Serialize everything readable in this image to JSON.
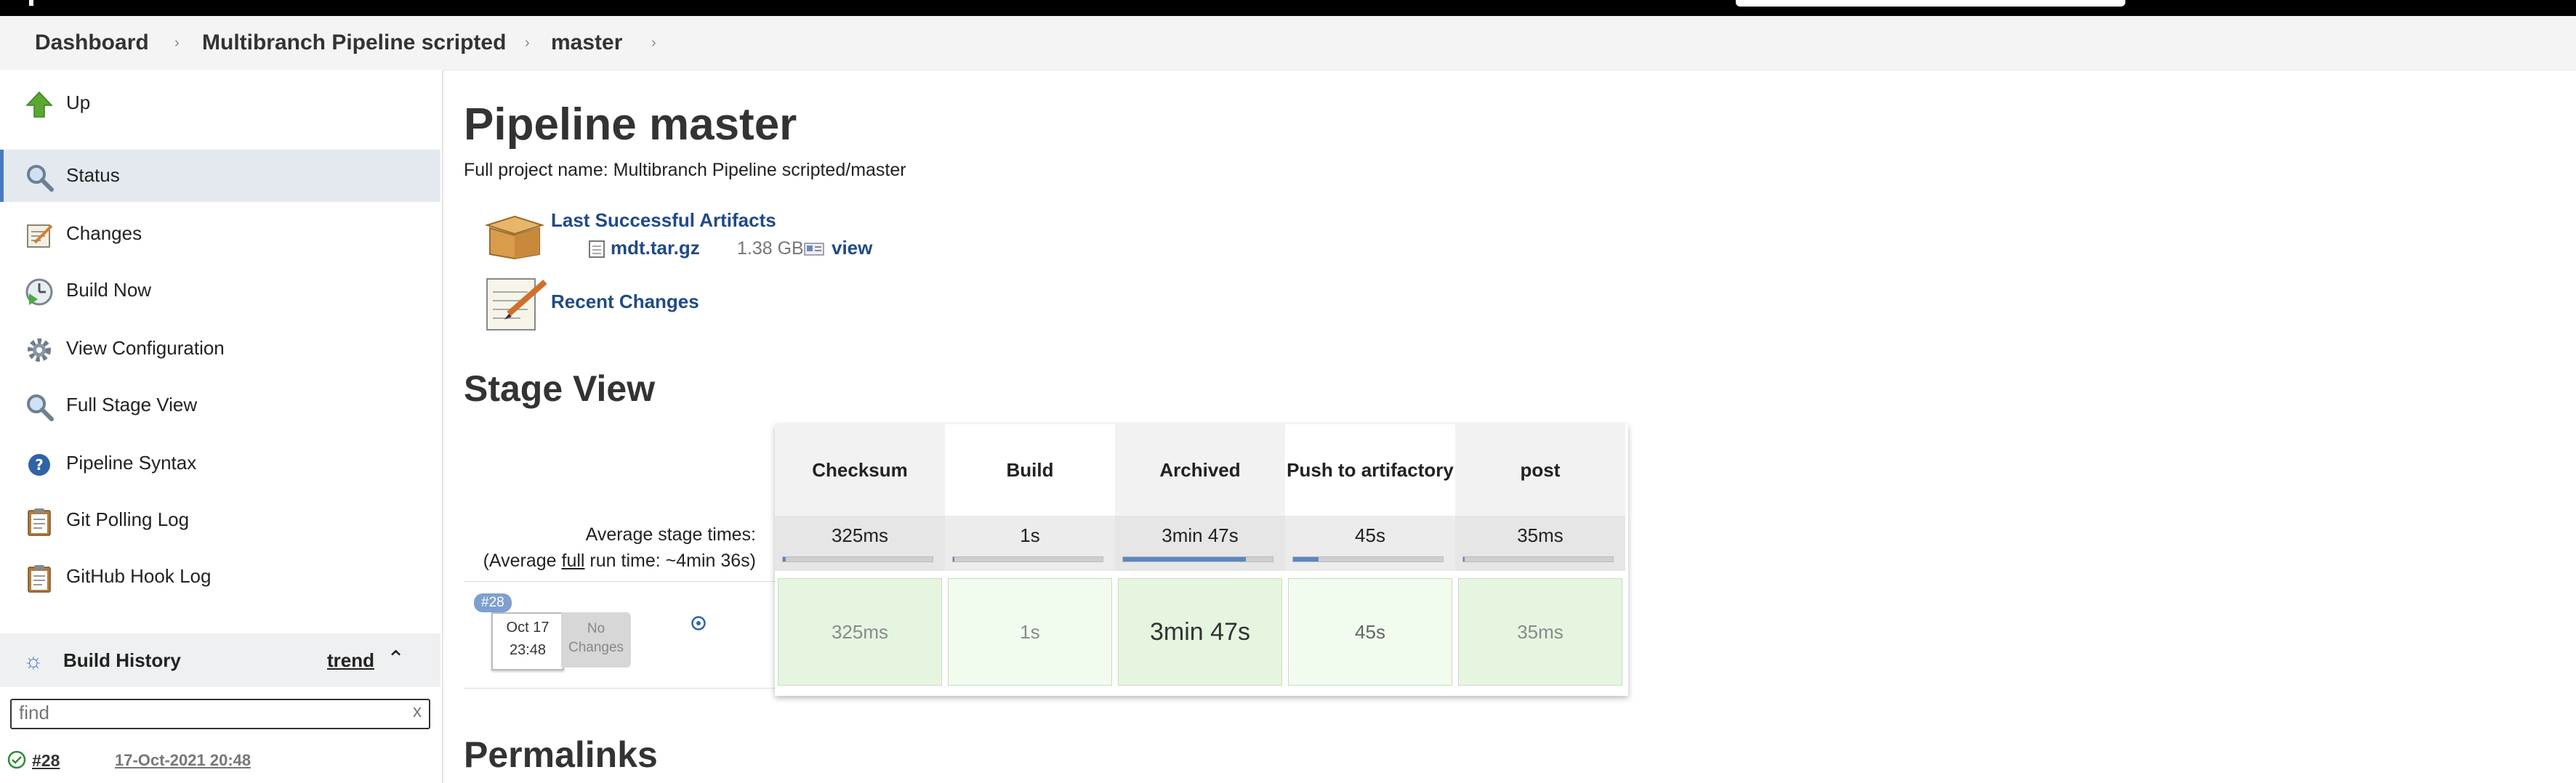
{
  "breadcrumbs": [
    {
      "label": "Dashboard"
    },
    {
      "label": "Multibranch Pipeline scripted"
    },
    {
      "label": "master"
    }
  ],
  "sidebar": {
    "items": [
      {
        "label": "Up",
        "icon": "up-arrow-icon"
      },
      {
        "label": "Status",
        "icon": "magnifier-icon",
        "active": true
      },
      {
        "label": "Changes",
        "icon": "notepad-icon"
      },
      {
        "label": "Build Now",
        "icon": "clock-play-icon"
      },
      {
        "label": "View Configuration",
        "icon": "gear-icon"
      },
      {
        "label": "Full Stage View",
        "icon": "magnifier-icon"
      },
      {
        "label": "Pipeline Syntax",
        "icon": "help-icon"
      },
      {
        "label": "Git Polling Log",
        "icon": "clipboard-icon"
      },
      {
        "label": "GitHub Hook Log",
        "icon": "clipboard-icon"
      }
    ]
  },
  "build_history": {
    "title": "Build History",
    "trend": "trend",
    "find_placeholder": "find",
    "clear": "x",
    "rows": [
      {
        "number": "#28",
        "date": "17-Oct-2021 20:48",
        "status": "success"
      }
    ]
  },
  "main": {
    "title": "Pipeline master",
    "full_name": "Full project name: Multibranch Pipeline scripted/master",
    "artifacts_label": "Last Successful Artifacts",
    "artifact": {
      "name": "mdt.tar.gz",
      "size": "1.38 GB",
      "view": "view"
    },
    "recent_changes": "Recent Changes",
    "stage_view_title": "Stage View",
    "permalinks_title": "Permalinks"
  },
  "stage_view": {
    "avg_label": "Average stage times:",
    "avg_full_prefix": "(Average ",
    "avg_full_word": "full",
    "avg_full_suffix": " run time: ~4min 36s)",
    "stages": [
      {
        "name": "Checksum",
        "avg": "325ms",
        "fill": 0.02,
        "cell": "325ms"
      },
      {
        "name": "Build",
        "avg": "1s",
        "fill": 0.01,
        "cell": "1s"
      },
      {
        "name": "Archived",
        "avg": "3min 47s",
        "fill": 0.82,
        "cell": "3min 47s"
      },
      {
        "name": "Push to artifactory",
        "avg": "45s",
        "fill": 0.17,
        "cell": "45s"
      },
      {
        "name": "post",
        "avg": "35ms",
        "fill": 0.01,
        "cell": "35ms"
      }
    ],
    "run": {
      "badge": "#28",
      "date": "Oct 17",
      "time": "23:48",
      "no_changes": "No Changes"
    },
    "colors": {
      "head_alt": "#f2f2f2",
      "cell_dark": "#e6f5e0",
      "cell_light": "#f1fbee",
      "bar_fill": "#5b86c6"
    }
  }
}
